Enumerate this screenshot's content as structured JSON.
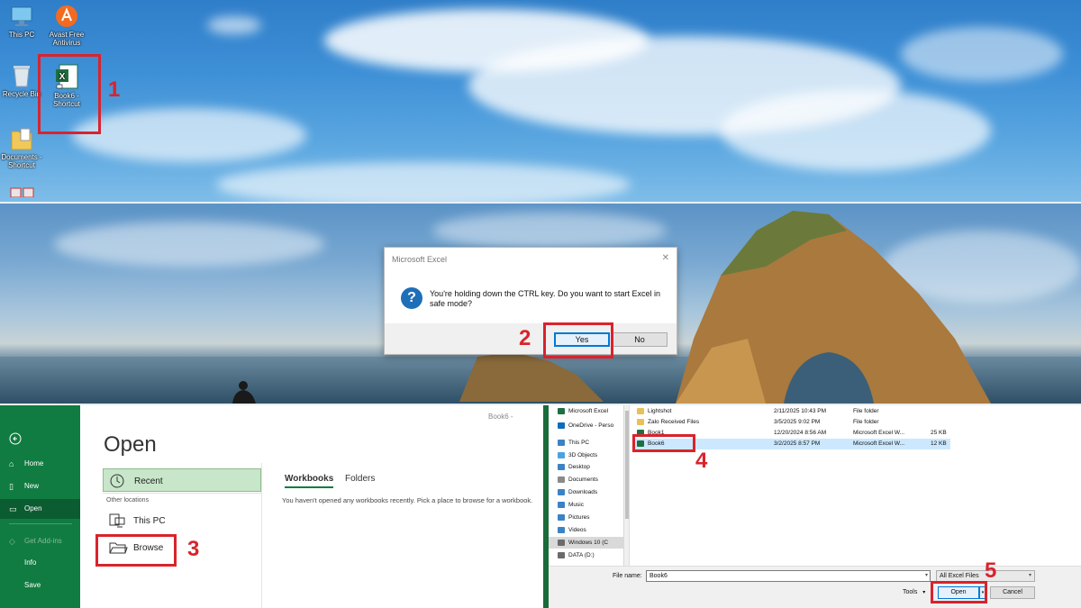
{
  "desktop": {
    "icons": [
      {
        "label": "This PC",
        "icon": "this-pc-icon"
      },
      {
        "label": "Avast Free Antivirus",
        "icon": "avast-icon"
      },
      {
        "label": "Recycle Bin",
        "icon": "recycle-bin-icon"
      },
      {
        "label": "Book6 - Shortcut",
        "icon": "excel-shortcut-icon"
      },
      {
        "label": "Documents - Shortcut",
        "icon": "documents-shortcut-icon"
      }
    ]
  },
  "steps": [
    "1",
    "2",
    "3",
    "4",
    "5"
  ],
  "safe_mode_dialog": {
    "title": "Microsoft Excel",
    "close": "✕",
    "message": "You're holding down the CTRL key. Do you want to start Excel in safe mode?",
    "yes_label": "Yes",
    "no_label": "No"
  },
  "backstage": {
    "tab_name": "Book6 - ",
    "title": "Open",
    "nav": [
      {
        "label": "",
        "icon": "back-arrow-icon"
      },
      {
        "label": "Home",
        "icon": "home-icon"
      },
      {
        "label": "New",
        "icon": "new-file-icon"
      },
      {
        "label": "Open",
        "icon": "folder-open-icon"
      },
      {
        "label": "Get Add-ins",
        "icon": "add-ins-icon"
      },
      {
        "label": "Info",
        "icon": ""
      },
      {
        "label": "Save",
        "icon": ""
      }
    ],
    "recent_label": "Recent",
    "other_locations_label": "Other locations",
    "this_pc_label": "This PC",
    "browse_label": "Browse",
    "workbooks_tab": "Workbooks",
    "folders_tab": "Folders",
    "empty_message": "You haven't opened any workbooks recently. Pick a place to browse for a workbook."
  },
  "file_dialog": {
    "nav_items": [
      {
        "label": "Microsoft Excel",
        "color": "#1d6f42"
      },
      {
        "label": "OneDrive - Perso",
        "color": "#0f6cbd"
      },
      {
        "label": "This PC",
        "color": "#3b83c4"
      },
      {
        "label": "3D Objects",
        "color": "#4aa3df"
      },
      {
        "label": "Desktop",
        "color": "#3b83c4"
      },
      {
        "label": "Documents",
        "color": "#8a8a8a"
      },
      {
        "label": "Downloads",
        "color": "#3b83c4"
      },
      {
        "label": "Music",
        "color": "#3b83c4"
      },
      {
        "label": "Pictures",
        "color": "#3b83c4"
      },
      {
        "label": "Videos",
        "color": "#3b83c4"
      },
      {
        "label": "Windows 10 (C",
        "color": "#6b6b6b"
      },
      {
        "label": "DATA (D:)",
        "color": "#6b6b6b"
      }
    ],
    "files": [
      {
        "name": "Lightshot",
        "date": "2/11/2025 10:43 PM",
        "type": "File folder",
        "size": ""
      },
      {
        "name": "Zalo Received Files",
        "date": "3/5/2025 9:02 PM",
        "type": "File folder",
        "size": ""
      },
      {
        "name": "Book1",
        "date": "12/20/2024 8:56 AM",
        "type": "Microsoft Excel W...",
        "size": "25 KB"
      },
      {
        "name": "Book6",
        "date": "3/2/2025 8:57 PM",
        "type": "Microsoft Excel W...",
        "size": "12 KB"
      }
    ],
    "file_name_label": "File name:",
    "file_name_value": "Book6",
    "file_type_value": "All Excel Files",
    "tools_label": "Tools",
    "open_label": "Open",
    "cancel_label": "Cancel",
    "dropdown_glyph": "▾"
  }
}
